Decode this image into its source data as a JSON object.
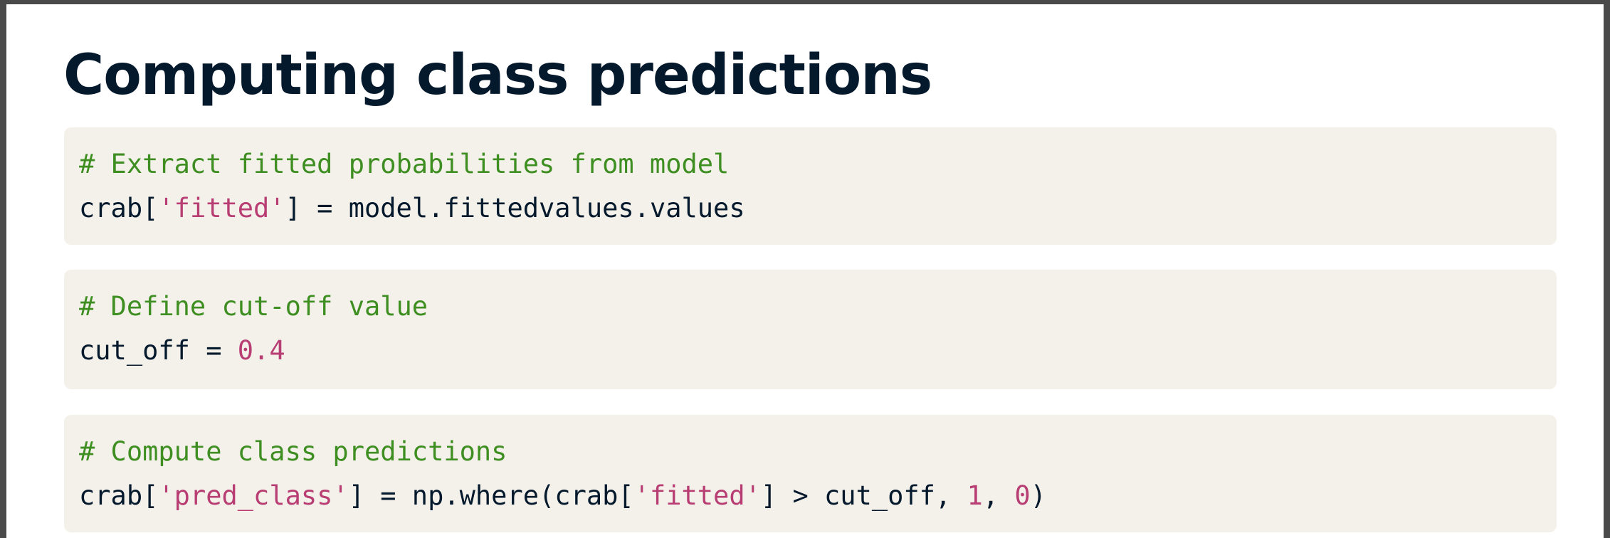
{
  "slide": {
    "title": "Computing class predictions"
  },
  "code_blocks": [
    {
      "comment": "# Extract fitted probabilities from model",
      "line": {
        "p1": "crab[",
        "s1": "'fitted'",
        "p2": "] = model.fittedvalues.values"
      }
    },
    {
      "comment": "# Define cut-off value",
      "line": {
        "p1": "cut_off = ",
        "n1": "0.4"
      }
    },
    {
      "comment": "# Compute class predictions",
      "line": {
        "p1": "crab[",
        "s1": "'pred_class'",
        "p2": "] = np.where(crab[",
        "s2": "'fitted'",
        "p3": "] > cut_off, ",
        "n1": "1",
        "p4": ", ",
        "n2": "0",
        "p5": ")"
      }
    }
  ],
  "colors": {
    "title": "#05192d",
    "code_background": "#f4f1eb",
    "comment": "#3e8e21",
    "string_literal": "#b83d73",
    "number_literal": "#b83d73",
    "code_text": "#05192d",
    "frame_border": "#4a4a4a"
  }
}
